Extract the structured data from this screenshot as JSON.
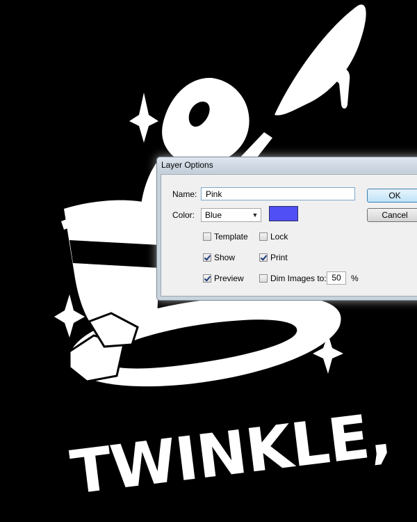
{
  "artwork": {
    "title": "TWINKLE,"
  },
  "dialog": {
    "title": "Layer Options",
    "name_label": "Name:",
    "name_value": "Pink",
    "color_label": "Color:",
    "color_value": "Blue",
    "swatch_color": "#4f4ff5",
    "template_label": "Template",
    "template_checked": false,
    "lock_label": "Lock",
    "lock_checked": false,
    "show_label": "Show",
    "show_checked": true,
    "print_label": "Print",
    "print_checked": true,
    "preview_label": "Preview",
    "preview_checked": true,
    "dim_label": "Dim Images to:",
    "dim_checked": false,
    "dim_value": "50",
    "dim_unit": "%",
    "ok_label": "OK",
    "cancel_label": "Cancel"
  }
}
